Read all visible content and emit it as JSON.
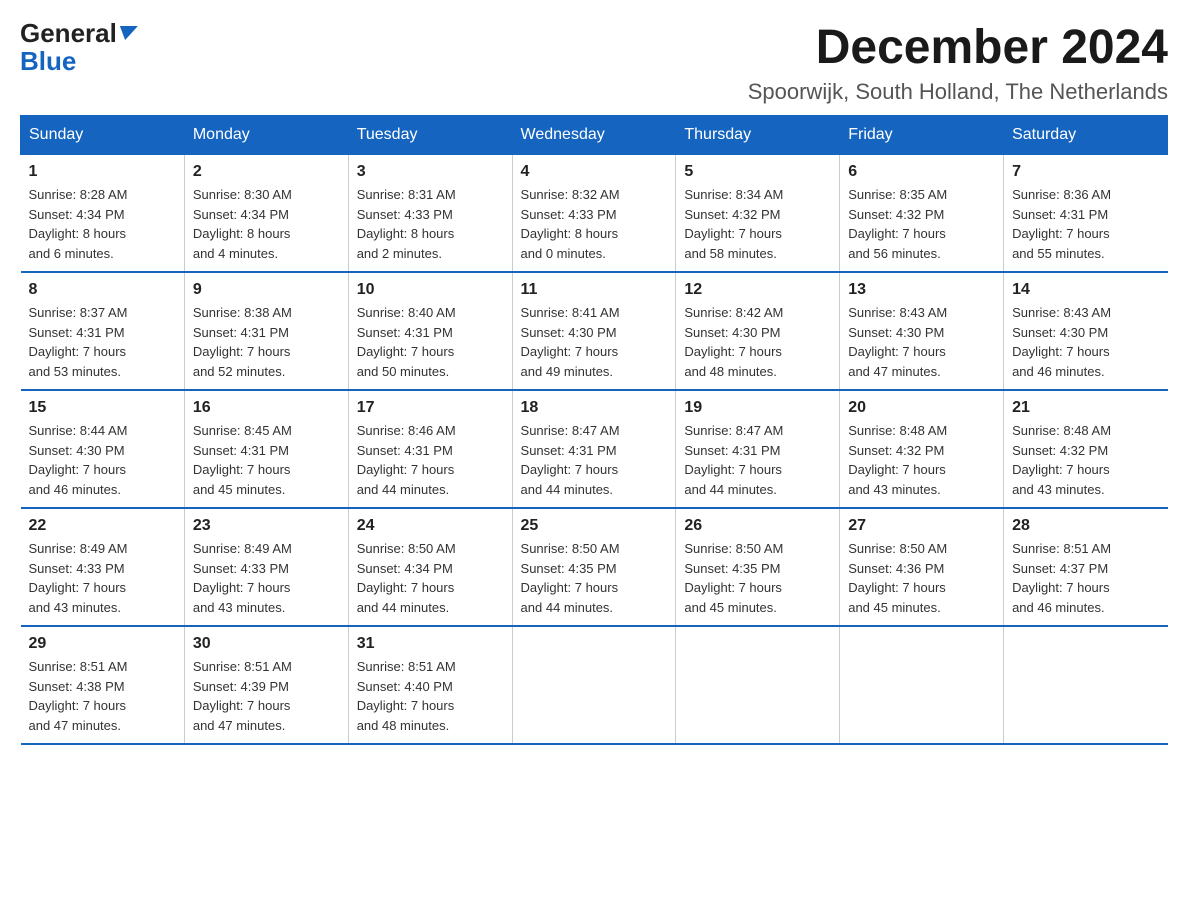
{
  "header": {
    "logo_line1": "General",
    "logo_line2": "Blue",
    "month_title": "December 2024",
    "location": "Spoorwijk, South Holland, The Netherlands"
  },
  "days_of_week": [
    "Sunday",
    "Monday",
    "Tuesday",
    "Wednesday",
    "Thursday",
    "Friday",
    "Saturday"
  ],
  "weeks": [
    [
      {
        "day": "1",
        "sunrise": "8:28 AM",
        "sunset": "4:34 PM",
        "daylight": "8 hours and 6 minutes."
      },
      {
        "day": "2",
        "sunrise": "8:30 AM",
        "sunset": "4:34 PM",
        "daylight": "8 hours and 4 minutes."
      },
      {
        "day": "3",
        "sunrise": "8:31 AM",
        "sunset": "4:33 PM",
        "daylight": "8 hours and 2 minutes."
      },
      {
        "day": "4",
        "sunrise": "8:32 AM",
        "sunset": "4:33 PM",
        "daylight": "8 hours and 0 minutes."
      },
      {
        "day": "5",
        "sunrise": "8:34 AM",
        "sunset": "4:32 PM",
        "daylight": "7 hours and 58 minutes."
      },
      {
        "day": "6",
        "sunrise": "8:35 AM",
        "sunset": "4:32 PM",
        "daylight": "7 hours and 56 minutes."
      },
      {
        "day": "7",
        "sunrise": "8:36 AM",
        "sunset": "4:31 PM",
        "daylight": "7 hours and 55 minutes."
      }
    ],
    [
      {
        "day": "8",
        "sunrise": "8:37 AM",
        "sunset": "4:31 PM",
        "daylight": "7 hours and 53 minutes."
      },
      {
        "day": "9",
        "sunrise": "8:38 AM",
        "sunset": "4:31 PM",
        "daylight": "7 hours and 52 minutes."
      },
      {
        "day": "10",
        "sunrise": "8:40 AM",
        "sunset": "4:31 PM",
        "daylight": "7 hours and 50 minutes."
      },
      {
        "day": "11",
        "sunrise": "8:41 AM",
        "sunset": "4:30 PM",
        "daylight": "7 hours and 49 minutes."
      },
      {
        "day": "12",
        "sunrise": "8:42 AM",
        "sunset": "4:30 PM",
        "daylight": "7 hours and 48 minutes."
      },
      {
        "day": "13",
        "sunrise": "8:43 AM",
        "sunset": "4:30 PM",
        "daylight": "7 hours and 47 minutes."
      },
      {
        "day": "14",
        "sunrise": "8:43 AM",
        "sunset": "4:30 PM",
        "daylight": "7 hours and 46 minutes."
      }
    ],
    [
      {
        "day": "15",
        "sunrise": "8:44 AM",
        "sunset": "4:30 PM",
        "daylight": "7 hours and 46 minutes."
      },
      {
        "day": "16",
        "sunrise": "8:45 AM",
        "sunset": "4:31 PM",
        "daylight": "7 hours and 45 minutes."
      },
      {
        "day": "17",
        "sunrise": "8:46 AM",
        "sunset": "4:31 PM",
        "daylight": "7 hours and 44 minutes."
      },
      {
        "day": "18",
        "sunrise": "8:47 AM",
        "sunset": "4:31 PM",
        "daylight": "7 hours and 44 minutes."
      },
      {
        "day": "19",
        "sunrise": "8:47 AM",
        "sunset": "4:31 PM",
        "daylight": "7 hours and 44 minutes."
      },
      {
        "day": "20",
        "sunrise": "8:48 AM",
        "sunset": "4:32 PM",
        "daylight": "7 hours and 43 minutes."
      },
      {
        "day": "21",
        "sunrise": "8:48 AM",
        "sunset": "4:32 PM",
        "daylight": "7 hours and 43 minutes."
      }
    ],
    [
      {
        "day": "22",
        "sunrise": "8:49 AM",
        "sunset": "4:33 PM",
        "daylight": "7 hours and 43 minutes."
      },
      {
        "day": "23",
        "sunrise": "8:49 AM",
        "sunset": "4:33 PM",
        "daylight": "7 hours and 43 minutes."
      },
      {
        "day": "24",
        "sunrise": "8:50 AM",
        "sunset": "4:34 PM",
        "daylight": "7 hours and 44 minutes."
      },
      {
        "day": "25",
        "sunrise": "8:50 AM",
        "sunset": "4:35 PM",
        "daylight": "7 hours and 44 minutes."
      },
      {
        "day": "26",
        "sunrise": "8:50 AM",
        "sunset": "4:35 PM",
        "daylight": "7 hours and 45 minutes."
      },
      {
        "day": "27",
        "sunrise": "8:50 AM",
        "sunset": "4:36 PM",
        "daylight": "7 hours and 45 minutes."
      },
      {
        "day": "28",
        "sunrise": "8:51 AM",
        "sunset": "4:37 PM",
        "daylight": "7 hours and 46 minutes."
      }
    ],
    [
      {
        "day": "29",
        "sunrise": "8:51 AM",
        "sunset": "4:38 PM",
        "daylight": "7 hours and 47 minutes."
      },
      {
        "day": "30",
        "sunrise": "8:51 AM",
        "sunset": "4:39 PM",
        "daylight": "7 hours and 47 minutes."
      },
      {
        "day": "31",
        "sunrise": "8:51 AM",
        "sunset": "4:40 PM",
        "daylight": "7 hours and 48 minutes."
      },
      null,
      null,
      null,
      null
    ]
  ],
  "labels": {
    "sunrise": "Sunrise:",
    "sunset": "Sunset:",
    "daylight": "Daylight:"
  }
}
